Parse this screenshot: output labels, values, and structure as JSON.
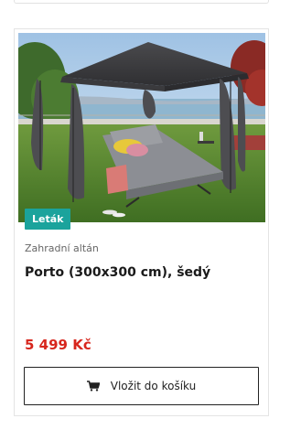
{
  "product": {
    "badge": "Leták",
    "category": "Zahradní altán",
    "title": "Porto (300x300 cm), šedý",
    "price": "5 499 Kč",
    "image_subject": "grey garden gazebo with curtains over a double lounger on a lawn by a lake"
  },
  "actions": {
    "add_to_cart_label": "Vložit do košíku",
    "add_to_cart_icon": "shopping-cart-icon"
  },
  "colors": {
    "badge_bg": "#1ba39c",
    "price": "#d7261d",
    "button_border": "#222222"
  }
}
